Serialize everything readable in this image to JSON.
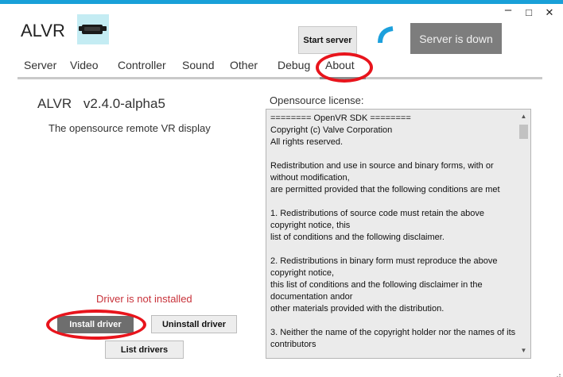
{
  "window": {
    "title": "ALVR",
    "accent_color": "#19a0d8",
    "controls": {
      "minimize": "–",
      "maximize": "□",
      "close": "✕"
    }
  },
  "header": {
    "logo_icon": "vr-headset-icon",
    "start_server_label": "Start server",
    "server_status": "Server is down"
  },
  "tabs": [
    {
      "label": "Server"
    },
    {
      "label": "Video"
    },
    {
      "label": "Controller"
    },
    {
      "label": "Sound"
    },
    {
      "label": "Other"
    },
    {
      "label": "Debug"
    },
    {
      "label": "About",
      "active": true
    }
  ],
  "about": {
    "app_name": "ALVR",
    "version": "v2.4.0-alpha5",
    "description": "The opensource remote VR display",
    "driver_status": "Driver is not installed",
    "driver_status_color": "#c8323a",
    "install_driver_label": "Install driver",
    "uninstall_driver_label": "Uninstall driver",
    "list_drivers_label": "List drivers"
  },
  "license": {
    "label": "Opensource license:",
    "text": "======== OpenVR SDK ========\nCopyright (c) Valve Corporation\nAll rights reserved.\n\nRedistribution and use in source and binary forms, with or without modification,\nare permitted provided that the following conditions are met\n\n1. Redistributions of source code must retain the above copyright notice, this\nlist of conditions and the following disclaimer.\n\n2. Redistributions in binary form must reproduce the above copyright notice,\nthis list of conditions and the following disclaimer in the documentation andor\nother materials provided with the distribution.\n\n3. Neither the name of the copyright holder nor the names of its contributors"
  },
  "annotation_color": "#e8141c"
}
